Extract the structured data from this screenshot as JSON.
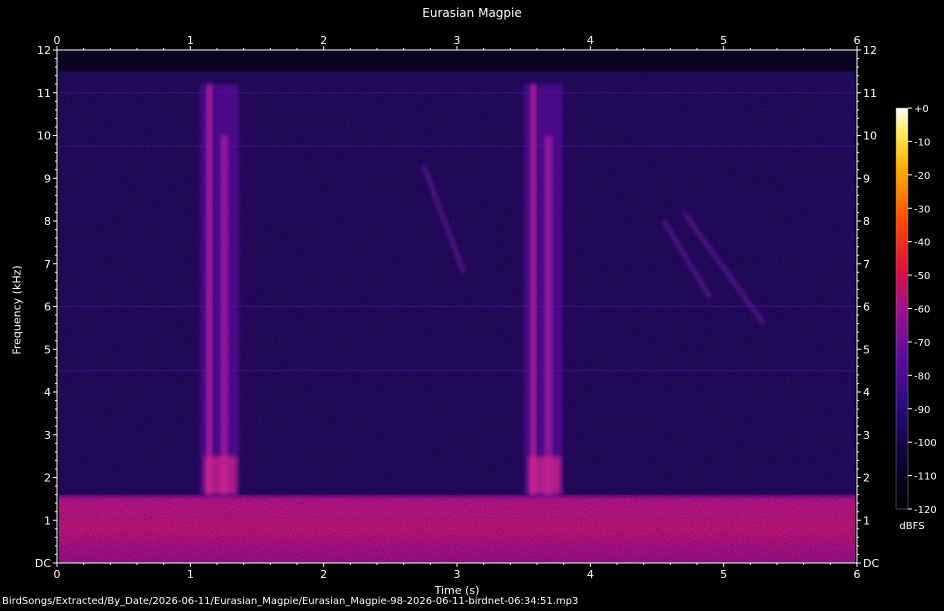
{
  "chart_data": {
    "type": "heatmap",
    "title": "Eurasian Magpie",
    "xlabel": "Time (s)",
    "ylabel": "Frequency (kHz)",
    "xlim": [
      0,
      6
    ],
    "ylim": [
      0,
      12
    ],
    "x_ticks": [
      "0",
      "1",
      "2",
      "3",
      "4",
      "5",
      "6"
    ],
    "y_ticks": [
      "DC",
      "1",
      "2",
      "3",
      "4",
      "5",
      "6",
      "7",
      "8",
      "9",
      "10",
      "11",
      "12"
    ],
    "colorbar": {
      "label": "dBFS",
      "range": [
        -120,
        0
      ],
      "ticks": [
        "+0",
        "-10",
        "-20",
        "-30",
        "-40",
        "-50",
        "-60",
        "-70",
        "-80",
        "-90",
        "-100",
        "-110",
        "-120"
      ]
    },
    "signal_band_max_khz": 11.5,
    "low_freq_noise_band_khz": [
      0,
      1.6
    ],
    "calls": [
      {
        "start_s": 1.12,
        "end_s": 1.32,
        "low_khz": 1.6,
        "high_khz": 11.2
      },
      {
        "start_s": 3.55,
        "end_s": 3.75,
        "low_khz": 1.6,
        "high_khz": 11.2
      }
    ],
    "faint_traces": [
      {
        "t0": 2.75,
        "f0": 9.3,
        "t1": 3.05,
        "f1": 6.8
      },
      {
        "t0": 4.55,
        "f0": 8.0,
        "t1": 4.9,
        "f1": 6.2
      },
      {
        "t0": 4.7,
        "f0": 8.2,
        "t1": 5.3,
        "f1": 5.6
      }
    ]
  },
  "file_path": "BirdSongs/Extracted/By_Date/2026-06-11/Eurasian_Magpie/Eurasian_Magpie-98-2026-06-11-birdnet-06:34:51.mp3"
}
